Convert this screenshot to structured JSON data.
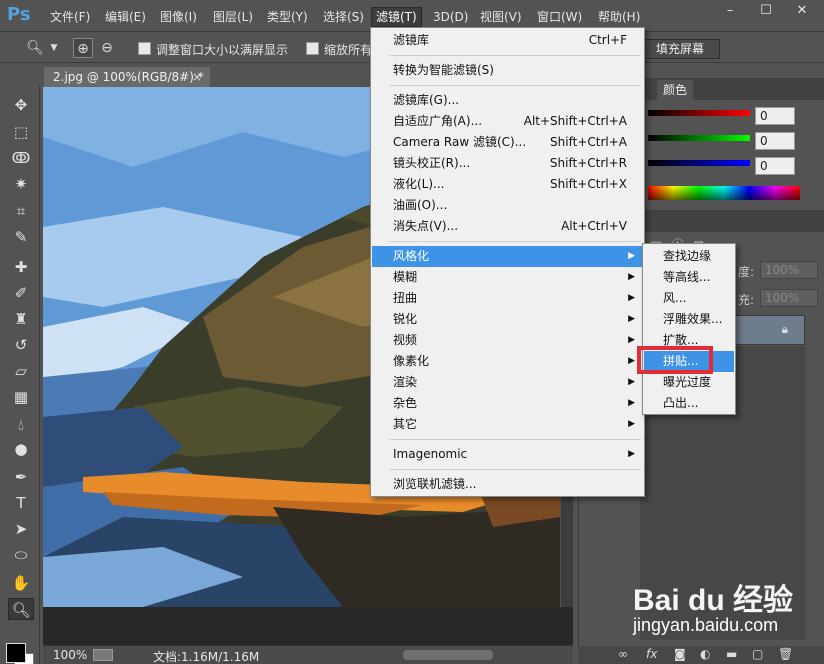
{
  "app": {
    "logo": "Ps"
  },
  "menubar": {
    "items": [
      "文件(F)",
      "编辑(E)",
      "图像(I)",
      "图层(L)",
      "类型(Y)",
      "选择(S)",
      "滤镜(T)",
      "3D(D)",
      "视图(V)",
      "窗口(W)",
      "帮助(H)"
    ],
    "active_index": 6,
    "window_controls": [
      "–",
      "☐",
      "✕"
    ]
  },
  "options": {
    "resize_windows_label": "调整窗口大小以满屏显示",
    "zoom_all_label": "缩放所有",
    "fill_screen_label": "填充屏幕"
  },
  "document": {
    "tab_title": "2.jpg @ 100%(RGB/8#) *",
    "tab_close": "×"
  },
  "status": {
    "zoom": "100%",
    "doc_info": "文档:1.16M/1.16M"
  },
  "panels": {
    "color_tab": "颜色",
    "rgb_values": [
      "0",
      "0",
      "0"
    ],
    "opacity_label": "度:",
    "opacity_value": "100%",
    "fill_label": "充:",
    "fill_value": "100%"
  },
  "filter_menu": {
    "filter_gallery_top": {
      "label": "滤镜库",
      "shortcut": "Ctrl+F"
    },
    "convert_smart": "转换为智能滤镜(S)",
    "items": [
      {
        "label": "滤镜库(G)...",
        "shortcut": ""
      },
      {
        "label": "自适应广角(A)...",
        "shortcut": "Alt+Shift+Ctrl+A"
      },
      {
        "label": "Camera Raw 滤镜(C)...",
        "shortcut": "Shift+Ctrl+A"
      },
      {
        "label": "镜头校正(R)...",
        "shortcut": "Shift+Ctrl+R"
      },
      {
        "label": "液化(L)...",
        "shortcut": "Shift+Ctrl+X"
      },
      {
        "label": "油画(O)...",
        "shortcut": ""
      },
      {
        "label": "消失点(V)...",
        "shortcut": "Alt+Ctrl+V"
      }
    ],
    "submenus": [
      "风格化",
      "模糊",
      "扭曲",
      "锐化",
      "视频",
      "像素化",
      "渲染",
      "杂色",
      "其它"
    ],
    "highlighted_submenu": "风格化",
    "imagenomic": "Imagenomic",
    "browse_online": "浏览联机滤镜..."
  },
  "stylize_menu": {
    "items": [
      "查找边缘",
      "等高线...",
      "风...",
      "浮雕效果...",
      "扩散...",
      "拼贴...",
      "曝光过度",
      "凸出..."
    ],
    "highlighted": "拼贴..."
  },
  "watermark": {
    "logo": "Bai du 经验",
    "sub": "jingyan.baidu.com"
  },
  "colors": {
    "menu_highlight": "#3e93e6",
    "annotation_red": "#e32d35",
    "ps_blue": "#4fa3e0"
  }
}
